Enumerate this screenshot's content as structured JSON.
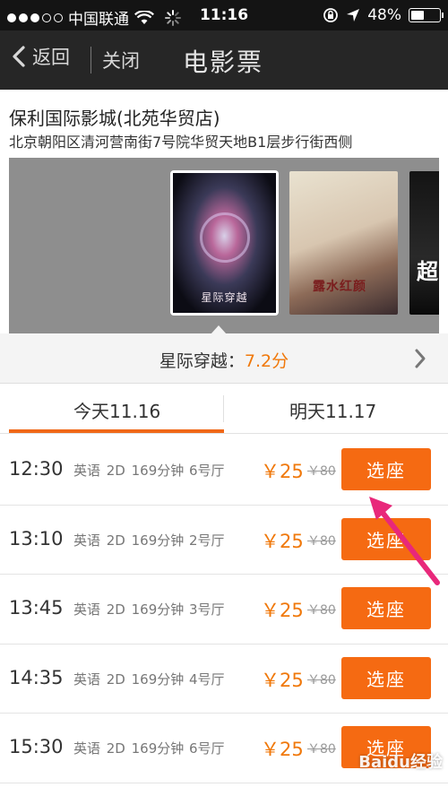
{
  "status_bar": {
    "carrier": "中国联通",
    "time": "11:16",
    "battery": "48%",
    "battery_level": 0.48
  },
  "nav": {
    "back_label": "返回",
    "close_label": "关闭",
    "title": "电影票"
  },
  "cinema": {
    "name": "保利国际影城(北苑华贸店)",
    "address": "北京朝阳区清河营南街7号院华贸天地B1层步行街西侧"
  },
  "posters": [
    {
      "title": "星际穿越",
      "icon": "poster-interstellar"
    },
    {
      "title": "露水红颜",
      "icon": "poster-lushui"
    },
    {
      "title": "超",
      "icon": "poster-lucy"
    }
  ],
  "movie": {
    "title": "星际穿越：",
    "score": "7.2分"
  },
  "tabs": [
    {
      "label": "今天11.16",
      "active": true
    },
    {
      "label": "明天11.17",
      "active": false
    }
  ],
  "showtimes": [
    {
      "time": "12:30",
      "info": "英语 2D 169分钟",
      "hall": "6号厅",
      "price": "￥25",
      "original": "￥80",
      "button": "选座"
    },
    {
      "time": "13:10",
      "info": "英语 2D 169分钟",
      "hall": "2号厅",
      "price": "￥25",
      "original": "￥80",
      "button": "选座"
    },
    {
      "time": "13:45",
      "info": "英语 2D 169分钟",
      "hall": "3号厅",
      "price": "￥25",
      "original": "￥80",
      "button": "选座"
    },
    {
      "time": "14:35",
      "info": "英语 2D 169分钟",
      "hall": "4号厅",
      "price": "￥25",
      "original": "￥80",
      "button": "选座"
    },
    {
      "time": "15:30",
      "info": "英语 2D 169分钟",
      "hall": "6号厅",
      "price": "￥25",
      "original": "￥80",
      "button": "选座"
    }
  ],
  "watermark": "Baidu经验",
  "colors": {
    "accent": "#f56a12",
    "price": "#f0780a",
    "navbar": "#262626",
    "annotation": "#e8287a"
  }
}
